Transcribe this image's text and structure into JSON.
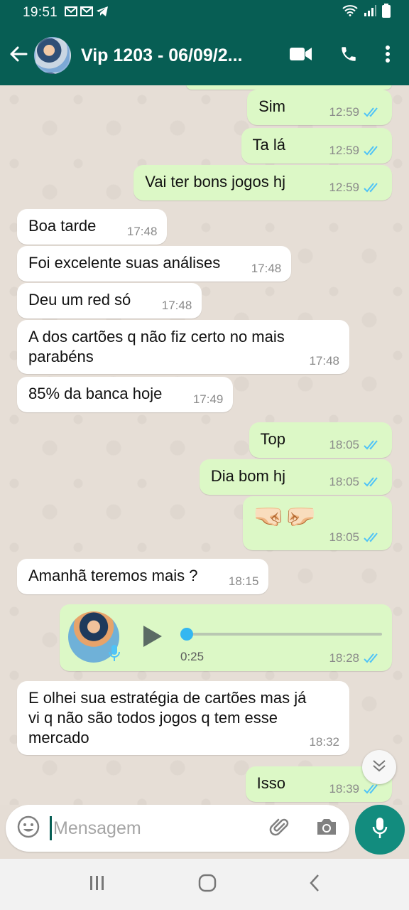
{
  "status_bar": {
    "time": "19:51"
  },
  "header": {
    "title": "Vip 1203 - 06/09/2..."
  },
  "messages": [
    {
      "dir": "out",
      "text": "Sim",
      "time": "12:59"
    },
    {
      "dir": "out",
      "text": "Ta lá",
      "time": "12:59"
    },
    {
      "dir": "out",
      "text": "Vai ter bons jogos hj",
      "time": "12:59"
    },
    {
      "dir": "in",
      "text": "Boa tarde",
      "time": "17:48"
    },
    {
      "dir": "in",
      "text": "Foi excelente suas análises",
      "time": "17:48"
    },
    {
      "dir": "in",
      "text": "Deu um red só",
      "time": "17:48"
    },
    {
      "dir": "in",
      "text": "A dos cartões q não fiz certo  no mais parabéns",
      "time": "17:48"
    },
    {
      "dir": "in",
      "text": "85% da banca hoje",
      "time": "17:49"
    },
    {
      "dir": "out",
      "text": "Top",
      "time": "18:05"
    },
    {
      "dir": "out",
      "text": "Dia bom hj",
      "time": "18:05"
    },
    {
      "dir": "out",
      "text": "🤜🏻🤛🏻",
      "time": "18:05"
    },
    {
      "dir": "in",
      "text": "Amanhã teremos mais ?",
      "time": "18:15"
    },
    {
      "dir": "out",
      "voice_duration": "0:25",
      "time": "18:28"
    },
    {
      "dir": "in",
      "text": "E  olhei sua estratégia de cartões mas já vi q não são todos jogos q tem esse mercado",
      "time": "18:32"
    },
    {
      "dir": "out",
      "text": "Isso",
      "time": "18:39"
    }
  ],
  "composer": {
    "placeholder": "Mensagem"
  },
  "colors": {
    "header": "#075e54",
    "outgoing": "#dcf8c6",
    "incoming": "#ffffff",
    "tick_read": "#4fc3f7",
    "fab": "#128c7e"
  }
}
